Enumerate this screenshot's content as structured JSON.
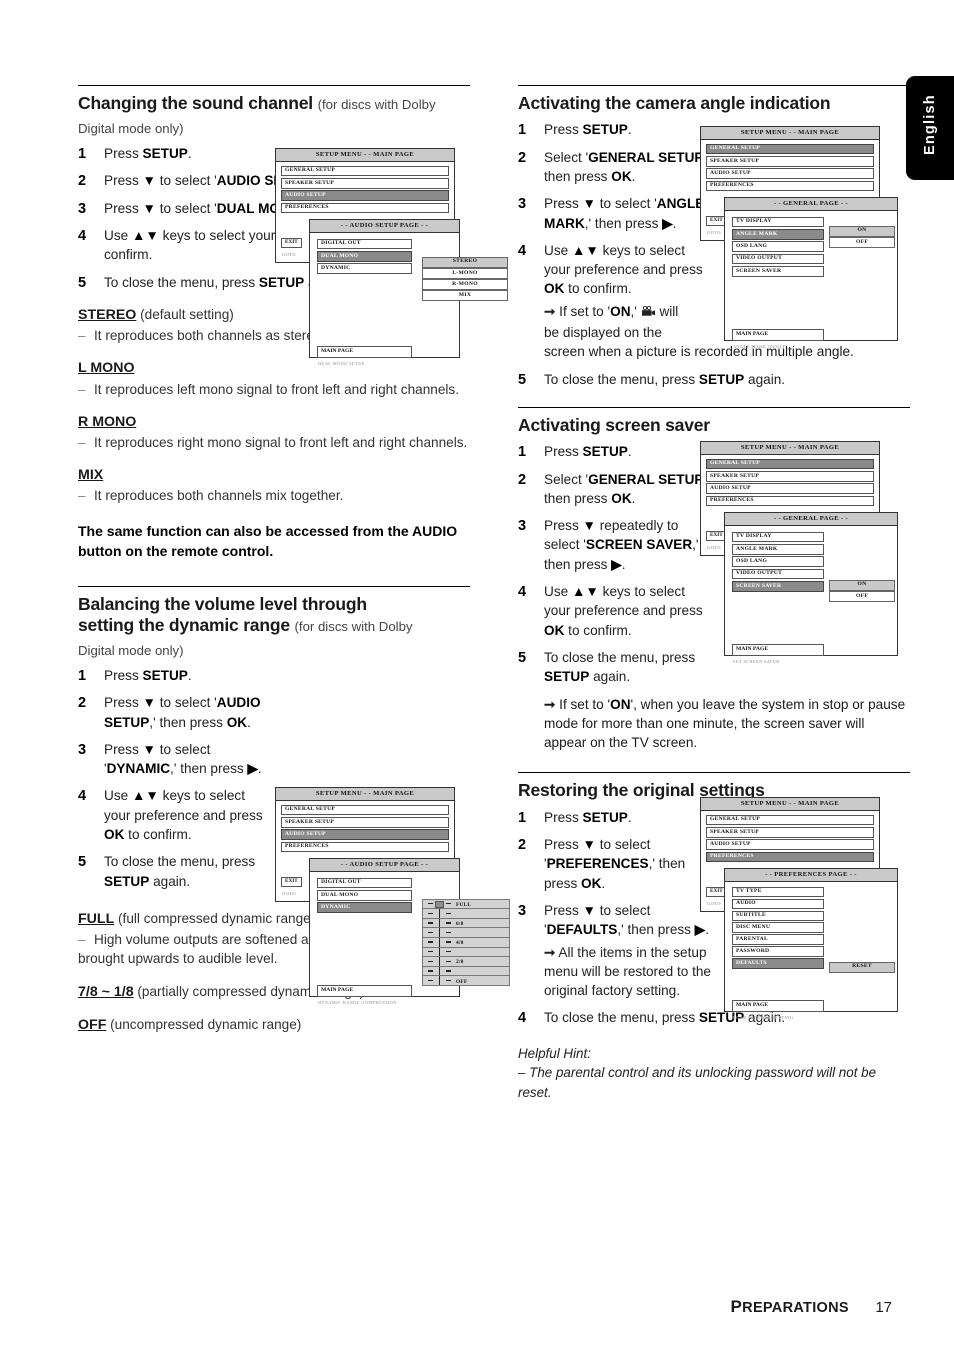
{
  "language_tab": {
    "label": "English"
  },
  "footer": {
    "chapter": "PREPARATIONS",
    "chapter_first": "P",
    "chapter_rest": "REPARATIONS",
    "page_number": "17"
  },
  "left_column": {
    "section1": {
      "heading": "Changing the sound channel",
      "heading_sub": "(for discs with Dolby",
      "heading_sub2": "Digital mode only)",
      "steps": [
        {
          "num": "1",
          "text_html": "Press SETUP."
        },
        {
          "num": "2",
          "text_html": "Press ▼ to select 'AUDIO SETUP,' then press OK."
        },
        {
          "num": "3",
          "text_html": "Press ▼ to select 'DUAL MONO', then press ▶."
        },
        {
          "num": "4",
          "text_html": "Use ▲▼ keys to select your preference and press OK to confirm."
        },
        {
          "num": "5",
          "text_html": "To close the menu, press SETUP again."
        }
      ],
      "terms": [
        {
          "term": "STEREO",
          "paren": "(default setting)",
          "desc": "It reproduces both channels as stereo."
        },
        {
          "term": "L MONO",
          "paren": "",
          "desc": "It reproduces left mono signal to front left and right channels."
        },
        {
          "term": "R MONO",
          "paren": "",
          "desc": "It reproduces right mono signal to front left and right channels."
        },
        {
          "term": "MIX",
          "paren": "",
          "desc": "It reproduces both channels mix together."
        }
      ],
      "bold_note": "The same function can also be accessed from the AUDIO button on the remote control."
    },
    "section2": {
      "heading_line1": "Balancing the volume level through",
      "heading_line2": "setting the dynamic range",
      "heading_sub": "(for discs with Dolby",
      "heading_sub2": "Digital mode only)",
      "steps": [
        {
          "num": "1",
          "text_html": "Press SETUP."
        },
        {
          "num": "2",
          "text_html": "Press ▼ to select 'AUDIO SETUP,' then press OK."
        },
        {
          "num": "3",
          "text_html": "Press ▼ to select 'DYNAMIC,' then press ▶."
        },
        {
          "num": "4",
          "text_html": "Use ▲▼ keys to select your preference and press OK to confirm."
        },
        {
          "num": "5",
          "text_html": "To close the menu, press SETUP again."
        }
      ],
      "terms": [
        {
          "term": "FULL",
          "paren": "(full compressed dynamic range)",
          "desc": "High volume outputs are softened and low volume outputs are brought upwards to audible level."
        },
        {
          "term": "7/8 ~ 1/8",
          "paren": "(partially compressed dynamic range)",
          "desc": ""
        },
        {
          "term": "OFF",
          "paren": "(uncompressed dynamic range)",
          "desc": ""
        }
      ]
    }
  },
  "right_column": {
    "section3": {
      "heading": "Activating the camera angle indication",
      "steps": [
        {
          "num": "1",
          "text_html": "Press SETUP."
        },
        {
          "num": "2",
          "text_html": "Select 'GENERAL SETUP,' then press OK."
        },
        {
          "num": "3",
          "text_html": "Press ▼ to select 'ANGLE MARK,' then press ▶."
        },
        {
          "num": "4",
          "text_html": "Use ▲▼ keys to select your preference and press OK to confirm.",
          "note": "If set to 'ON,' [camera] will be displayed on the screen when a picture is recorded in multiple angle."
        },
        {
          "num": "5",
          "text_html": "To close the menu, press SETUP again."
        }
      ]
    },
    "section4": {
      "heading": "Activating screen saver",
      "steps": [
        {
          "num": "1",
          "text_html": "Press SETUP."
        },
        {
          "num": "2",
          "text_html": "Select 'GENERAL SETUP,' then press OK."
        },
        {
          "num": "3",
          "text_html": "Press ▼ repeatedly to select 'SCREEN SAVER,' then press ▶."
        },
        {
          "num": "4",
          "text_html": "Use ▲▼ keys to select your preference and press OK to confirm."
        },
        {
          "num": "5",
          "text_html": "To close the menu, press SETUP again.",
          "note": "If set to 'ON', when you leave the system in stop or pause mode for more than one minute, the screen saver will appear on the TV screen."
        }
      ]
    },
    "section5": {
      "heading": "Restoring the original settings",
      "steps": [
        {
          "num": "1",
          "text_html": "Press SETUP."
        },
        {
          "num": "2",
          "text_html": "Press ▼ to select 'PREFERENCES,' then press OK."
        },
        {
          "num": "3",
          "text_html": "Press ▼ to select 'DEFAULTS,' then press ▶.",
          "note": "All the items in the setup menu will be restored to the original factory setting."
        },
        {
          "num": "4",
          "text_html": "To close the menu, press SETUP again."
        }
      ],
      "hint_title": "Helpful Hint:",
      "hint_text": "–  The parental control and its unlocking password will not be reset."
    }
  },
  "osd": {
    "main_title": "SETUP MENU - - MAIN PAGE",
    "main_items": [
      "GENERAL SETUP",
      "SPEAKER SETUP",
      "AUDIO SETUP",
      "PREFERENCES"
    ],
    "exit_label": "EXIT",
    "goto_label": "GOTO",
    "main_page_label": "MAIN PAGE",
    "audio_page": {
      "title": "- - AUDIO SETUP PAGE - -",
      "items": [
        "DIGITAL OUT",
        "DUAL MONO",
        "DYNAMIC"
      ],
      "dual_mono_values": [
        "STEREO",
        "L-MONO",
        "R-MONO",
        "MIX"
      ],
      "selected_index": 1,
      "selected_value_index": 0,
      "footer": "DUAL MONO SETUP"
    },
    "audio_page_dynamic": {
      "title": "- - AUDIO SETUP PAGE - -",
      "items": [
        "DIGITAL OUT",
        "DUAL MONO",
        "DYNAMIC"
      ],
      "selected_index": 2,
      "slider_labels": [
        "FULL",
        "",
        "6/8",
        "",
        "4/8",
        "",
        "2/8",
        "",
        "OFF"
      ],
      "knob_row": 0,
      "footer": "DYNAMIC RANGE COMPRESSION"
    },
    "general_page_angle": {
      "title": "- - GENERAL PAGE - -",
      "items": [
        "TV DISPLAY",
        "ANGLE MARK",
        "OSD LANG",
        "VIDEO OUTPUT",
        "SCREEN SAVER"
      ],
      "selected_index": 1,
      "values": [
        "ON",
        "OFF"
      ],
      "selected_value_index": 0,
      "footer": "ANGLE MARK ON/OFF"
    },
    "general_page_saver": {
      "title": "- - GENERAL PAGE - -",
      "items": [
        "TV DISPLAY",
        "ANGLE MARK",
        "OSD LANG",
        "VIDEO OUTPUT",
        "SCREEN SAVER"
      ],
      "selected_index": 4,
      "values": [
        "ON",
        "OFF"
      ],
      "selected_value_index": 0,
      "footer": "SET SCREEN SAVER"
    },
    "preferences_page": {
      "title": "- - PREFERENCES PAGE - -",
      "items": [
        "TV TYPE",
        "AUDIO",
        "SUBTITLE",
        "DISC MENU",
        "PARENTAL",
        "PASSWORD",
        "DEFAULTS"
      ],
      "selected_index": 6,
      "values": [
        "RESET"
      ],
      "footer": "LOAD FACTORY SETTING"
    }
  }
}
